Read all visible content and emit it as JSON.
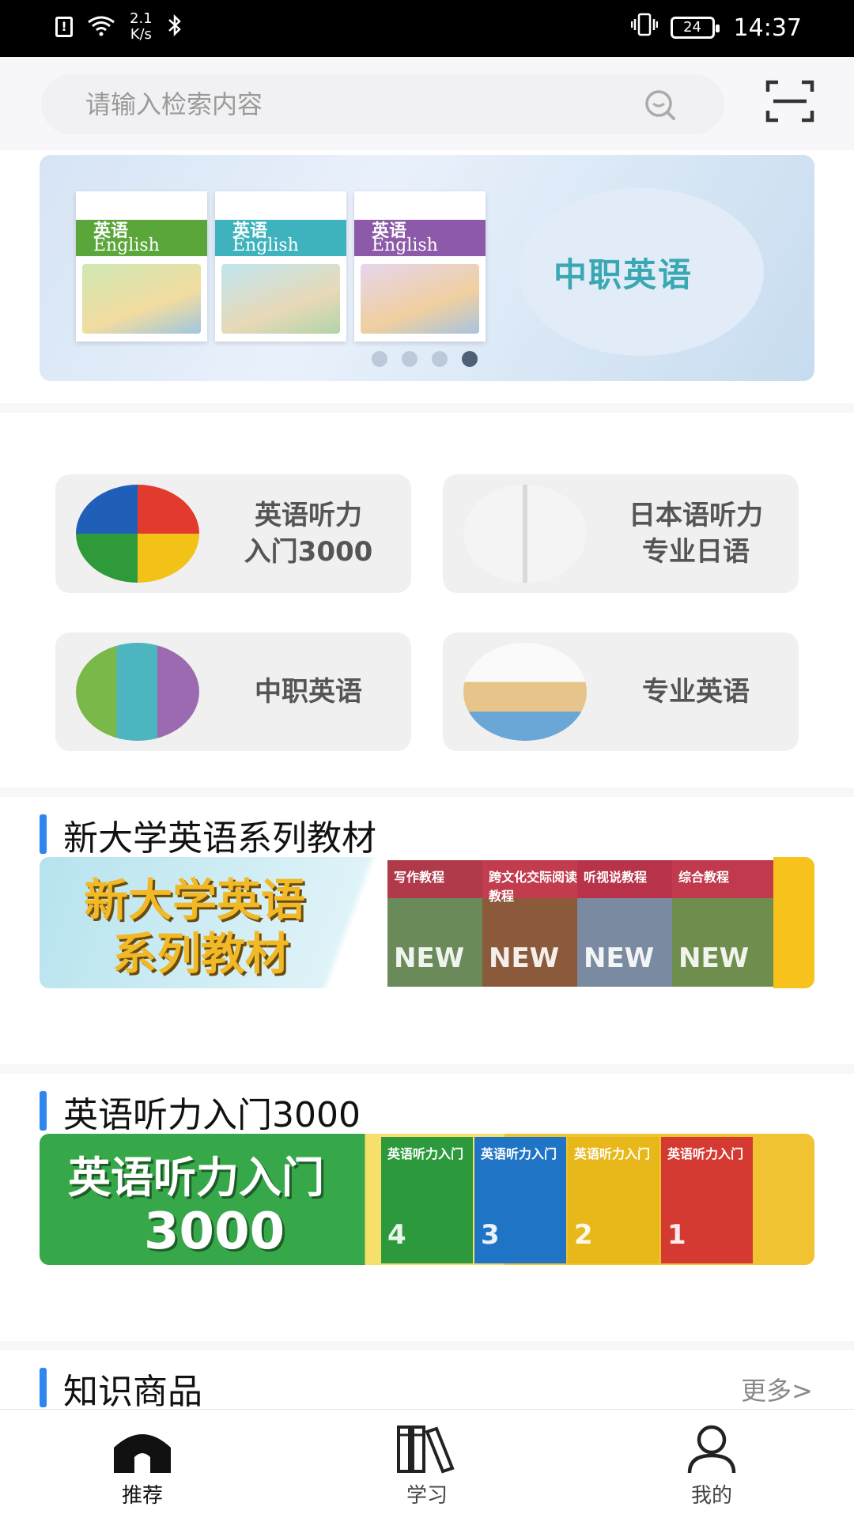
{
  "status_bar": {
    "speed_top": "2.1",
    "speed_bottom": "K/s",
    "battery": "24",
    "time": "14:37"
  },
  "search": {
    "placeholder": "请输入检索内容"
  },
  "banner": {
    "title": "中职英语",
    "books": [
      {
        "t1": "英语",
        "t2": "English",
        "color": "#5aa63b"
      },
      {
        "t1": "英语",
        "t2": "English",
        "color": "#3fb3bd"
      },
      {
        "t1": "英语",
        "t2": "English",
        "color": "#8c5aa8"
      }
    ],
    "slides": 4,
    "active_slide": 4
  },
  "categories": [
    {
      "line1": "英语听力",
      "line2": "入门3000"
    },
    {
      "line1": "日本语听力",
      "line2": "专业日语"
    },
    {
      "line1": "中职英语",
      "line2": ""
    },
    {
      "line1": "专业英语",
      "line2": ""
    }
  ],
  "sections": [
    {
      "title": "新大学英语系列教材",
      "promo_line1": "新大学英语",
      "promo_line2": "系列教材",
      "book_badge": "NEW",
      "book_titles": [
        "写作教程",
        "跨文化交际阅读教程",
        "听视说教程",
        "综合教程"
      ]
    },
    {
      "title": "英语听力入门3000",
      "promo_line1": "英语听力入门",
      "promo_line2": "3000",
      "book_numbers": [
        "4",
        "3",
        "2",
        "1"
      ],
      "book_title": "英语听力入门"
    },
    {
      "title": "知识商品",
      "more": "更多>"
    }
  ],
  "tabbar": [
    {
      "label": "推荐",
      "icon": "home-icon",
      "active": true
    },
    {
      "label": "学习",
      "icon": "books-icon",
      "active": false
    },
    {
      "label": "我的",
      "icon": "person-icon",
      "active": false
    }
  ]
}
